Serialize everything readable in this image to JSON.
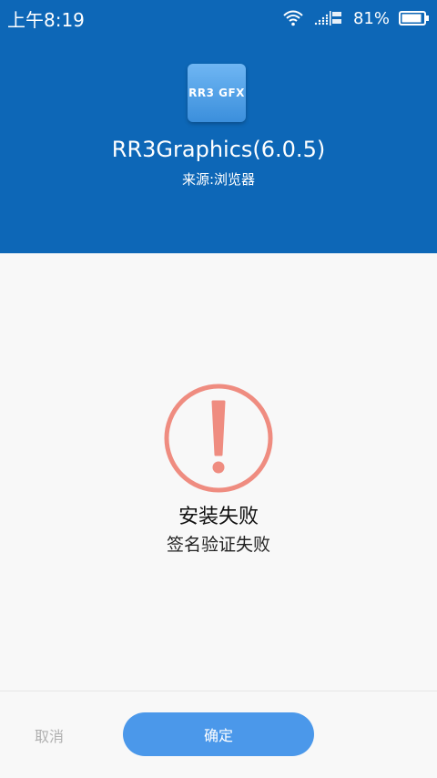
{
  "status_bar": {
    "time": "上午8:19",
    "battery": "81%"
  },
  "app": {
    "icon_text": "RR3 GFX",
    "name": "RR3Graphics(6.0.5)",
    "source": "来源:浏览器"
  },
  "result": {
    "title": "安装失败",
    "subtitle": "签名验证失败"
  },
  "actions": {
    "cancel": "取消",
    "confirm": "确定"
  },
  "colors": {
    "header": "#0d67b7",
    "accent": "#4b98ea",
    "error": "#ef8c80"
  }
}
